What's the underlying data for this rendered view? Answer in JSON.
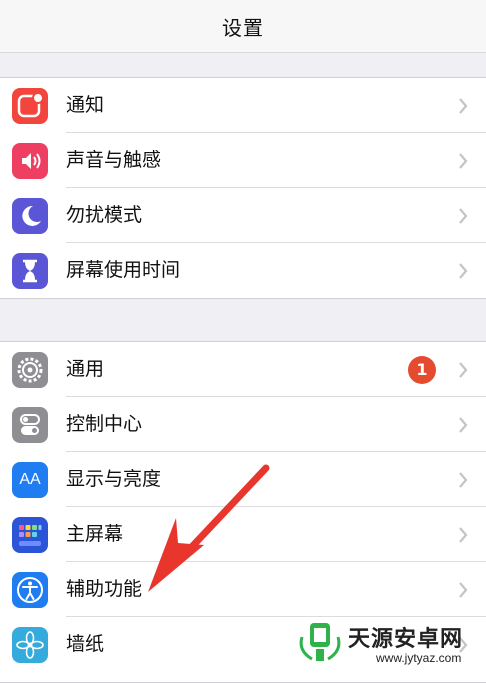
{
  "nav": {
    "title": "设置"
  },
  "group1": [
    {
      "label": "通知",
      "icon": "notifications-icon",
      "color": "#f2453d"
    },
    {
      "label": "声音与触感",
      "icon": "speaker-icon",
      "color": "#ee3f62"
    },
    {
      "label": "勿扰模式",
      "icon": "moon-icon",
      "color": "#5b56d6"
    },
    {
      "label": "屏幕使用时间",
      "icon": "hourglass-icon",
      "color": "#5b56d6"
    }
  ],
  "group2": [
    {
      "label": "通用",
      "icon": "gear-icon",
      "color": "#8e8e93",
      "badge": "1"
    },
    {
      "label": "控制中心",
      "icon": "toggle-icon",
      "color": "#8e8e93"
    },
    {
      "label": "显示与亮度",
      "icon": "text-size-icon",
      "color": "#1f7cf1",
      "glyph": "AA"
    },
    {
      "label": "主屏幕",
      "icon": "home-screen-icon",
      "color": "#2b55d6"
    },
    {
      "label": "辅助功能",
      "icon": "accessibility-icon",
      "color": "#1f7cf1"
    },
    {
      "label": "墙纸",
      "icon": "flower-icon",
      "color": "#35aadc"
    }
  ],
  "watermark": {
    "name": "天源安卓网",
    "url": "www.jytyaz.com"
  },
  "colors": {
    "accent": "#f2453d",
    "badge": "#e54b2f",
    "arrow": "#e8362c"
  }
}
